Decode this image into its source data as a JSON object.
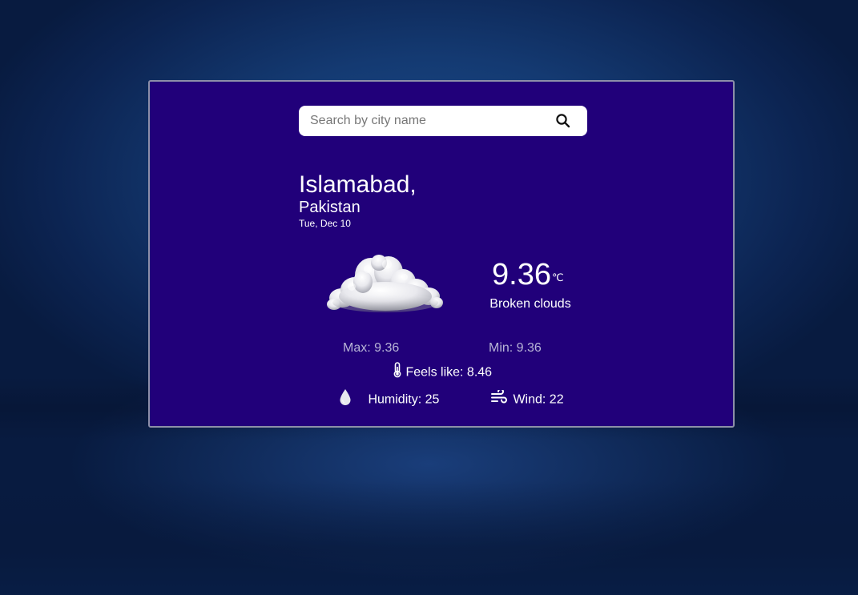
{
  "search": {
    "placeholder": "Search by city name",
    "value": "",
    "icon": "search-icon"
  },
  "location": {
    "city": "Islamabad,",
    "country": "Pakistan",
    "date": "Tue, Dec 10"
  },
  "weather": {
    "icon": "cloud-icon",
    "temperature": "9.36",
    "unit": "℃",
    "description": "Broken clouds",
    "max_label": "Max: 9.36",
    "min_label": "Min: 9.36",
    "feels_like_label": "Feels like: 8.46",
    "humidity_label": "Humidity: 25",
    "wind_label": "Wind: 22"
  },
  "colors": {
    "card_background": "#21007a",
    "card_border": "#8c8fa8",
    "page_background": "#143a72",
    "muted_text": "#b8b4d6"
  }
}
